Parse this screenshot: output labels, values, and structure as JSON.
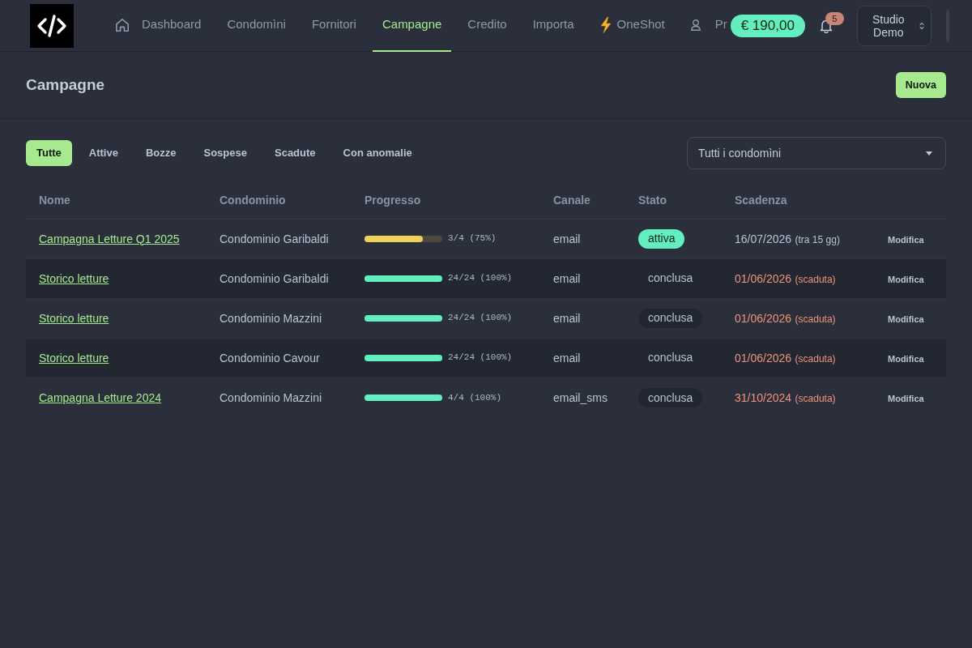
{
  "header": {
    "nav": [
      {
        "label": "Dashboard",
        "kind": "home",
        "selected": false
      },
      {
        "label": "Condomìni",
        "kind": "plain",
        "selected": false
      },
      {
        "label": "Fornitori",
        "kind": "plain",
        "selected": false
      },
      {
        "label": "Campagne",
        "kind": "plain",
        "selected": true
      },
      {
        "label": "Credito",
        "kind": "plain",
        "selected": false
      },
      {
        "label": "Importa",
        "kind": "plain",
        "selected": false
      },
      {
        "label": "OneShot",
        "kind": "flash",
        "selected": false
      },
      {
        "label": "Pr",
        "kind": "profile",
        "selected": false
      }
    ],
    "balance": "€ 190,00",
    "notifications": {
      "count": "5"
    },
    "studio": "Studio Demo"
  },
  "page": {
    "title": "Campagne",
    "new_button": "Nuova"
  },
  "filters": [
    {
      "label": "Tutte",
      "selected": true
    },
    {
      "label": "Attive",
      "selected": false
    },
    {
      "label": "Bozze",
      "selected": false
    },
    {
      "label": "Sospese",
      "selected": false
    },
    {
      "label": "Scadute",
      "selected": false
    },
    {
      "label": "Con anomalie",
      "selected": false
    }
  ],
  "condominium_select": {
    "value": "Tutti i condomìni"
  },
  "table": {
    "columns": [
      "Nome",
      "Condominio",
      "Progresso",
      "Canale",
      "Stato",
      "Scadenza"
    ],
    "rows": [
      {
        "name": "Campagna Letture Q1 2025",
        "condominium": "Condominio Garibaldi",
        "progress": {
          "level": 0.75,
          "reading": "3/4 (75%)"
        },
        "channel": "email",
        "status": {
          "label": "attiva",
          "kind": "active"
        },
        "deadline": {
          "date": "16/07/2026",
          "note": "(tra 15 gg)",
          "expired": false
        },
        "action": "Modifica"
      },
      {
        "name": "Storico letture",
        "condominium": "Condominio Garibaldi",
        "progress": {
          "level": 1,
          "reading": "24/24 (100%)"
        },
        "channel": "email",
        "status": {
          "label": "conclusa",
          "kind": "closed"
        },
        "deadline": {
          "date": "01/06/2026",
          "note": "(scaduta)",
          "expired": true
        },
        "action": "Modifica"
      },
      {
        "name": "Storico letture",
        "condominium": "Condominio Mazzini",
        "progress": {
          "level": 1,
          "reading": "24/24 (100%)"
        },
        "channel": "email",
        "status": {
          "label": "conclusa",
          "kind": "closed"
        },
        "deadline": {
          "date": "01/06/2026",
          "note": "(scaduta)",
          "expired": true
        },
        "action": "Modifica"
      },
      {
        "name": "Storico letture",
        "condominium": "Condominio Cavour",
        "progress": {
          "level": 1,
          "reading": "24/24 (100%)"
        },
        "channel": "email",
        "status": {
          "label": "conclusa",
          "kind": "closed"
        },
        "deadline": {
          "date": "01/06/2026",
          "note": "(scaduta)",
          "expired": true
        },
        "action": "Modifica"
      },
      {
        "name": "Campagna Letture 2024",
        "condominium": "Condominio Mazzini",
        "progress": {
          "level": 1,
          "reading": "4/4 (100%)"
        },
        "channel": "email_sms",
        "status": {
          "label": "conclusa",
          "kind": "closed"
        },
        "deadline": {
          "date": "31/10/2024",
          "note": "(scaduta)",
          "expired": true
        },
        "action": "Modifica"
      }
    ]
  }
}
